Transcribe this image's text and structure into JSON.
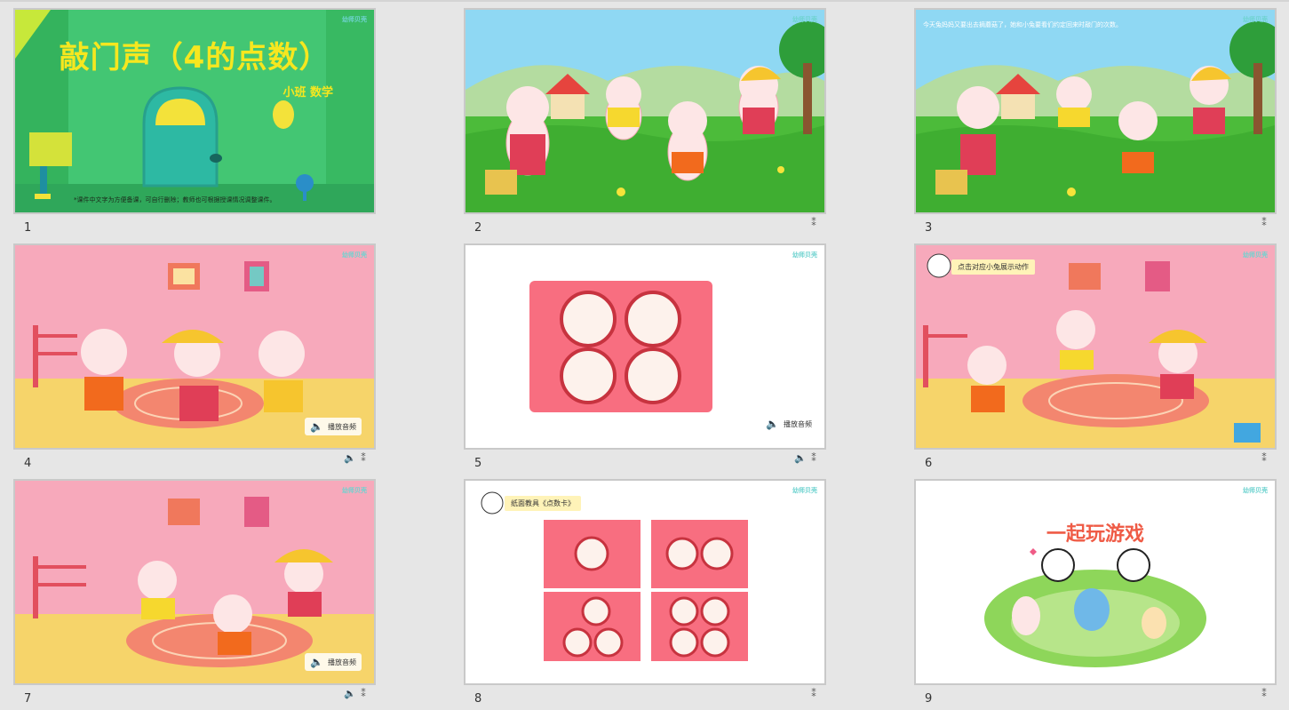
{
  "slides": [
    {
      "number": "1",
      "title": "敲门声（4的点数）",
      "subtitle": "小班 数学",
      "note": "*课件中文字为方便备课，可自行删除；教师也可根据授课情况调整课件。",
      "logo": "幼师贝壳",
      "icons": []
    },
    {
      "number": "2",
      "logo": "幼师贝壳",
      "icons": [
        "star"
      ]
    },
    {
      "number": "3",
      "note": "今天兔妈妈又要出去摘蘑菇了，她和小兔要看们约定回来时敲门的次数。",
      "logo": "幼师贝壳",
      "icons": [
        "star"
      ]
    },
    {
      "number": "4",
      "audio_label": "播放音频",
      "logo": "幼师贝壳",
      "icons": [
        "speaker",
        "star"
      ]
    },
    {
      "number": "5",
      "audio_label": "播放音频",
      "logo": "幼师贝壳",
      "icons": [
        "speaker",
        "star"
      ]
    },
    {
      "number": "6",
      "hint": "点击对应小兔展示动作",
      "logo": "幼师贝壳",
      "icons": [
        "star"
      ]
    },
    {
      "number": "7",
      "audio_label": "播放音频",
      "logo": "幼师贝壳",
      "icons": [
        "speaker",
        "star"
      ]
    },
    {
      "number": "8",
      "hint": "纸面教具《点数卡》",
      "logo": "幼师贝壳",
      "icons": [
        "star"
      ]
    },
    {
      "number": "9",
      "title": "一起玩游戏",
      "logo": "幼师贝壳",
      "icons": [
        "star"
      ]
    }
  ],
  "colors": {
    "background": "#e6e6e6",
    "card_pink": "#f86e80",
    "title_yellow": "#f6e71f",
    "game_title": "#ef5b46"
  }
}
